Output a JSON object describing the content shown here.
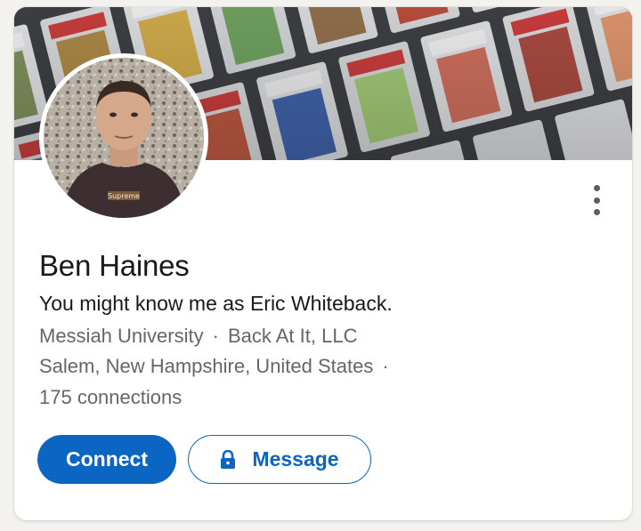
{
  "profile": {
    "name": "Ben Haines",
    "headline": "You might know me as Eric Whiteback.",
    "education": "Messiah University",
    "company": "Back At It, LLC",
    "location": "Salem, New Hampshire, United States",
    "connections": "175 connections",
    "separator": "·",
    "avatar_shirt_text": "Supreme"
  },
  "actions": {
    "connect_label": "Connect",
    "message_label": "Message"
  },
  "icons": {
    "more": "more-vertical-icon",
    "lock": "lock-icon"
  },
  "colors": {
    "accent": "#0a66c2",
    "text_primary": "#191919",
    "text_secondary": "#666666",
    "shirt_text_bg": "#7a5a3a"
  }
}
